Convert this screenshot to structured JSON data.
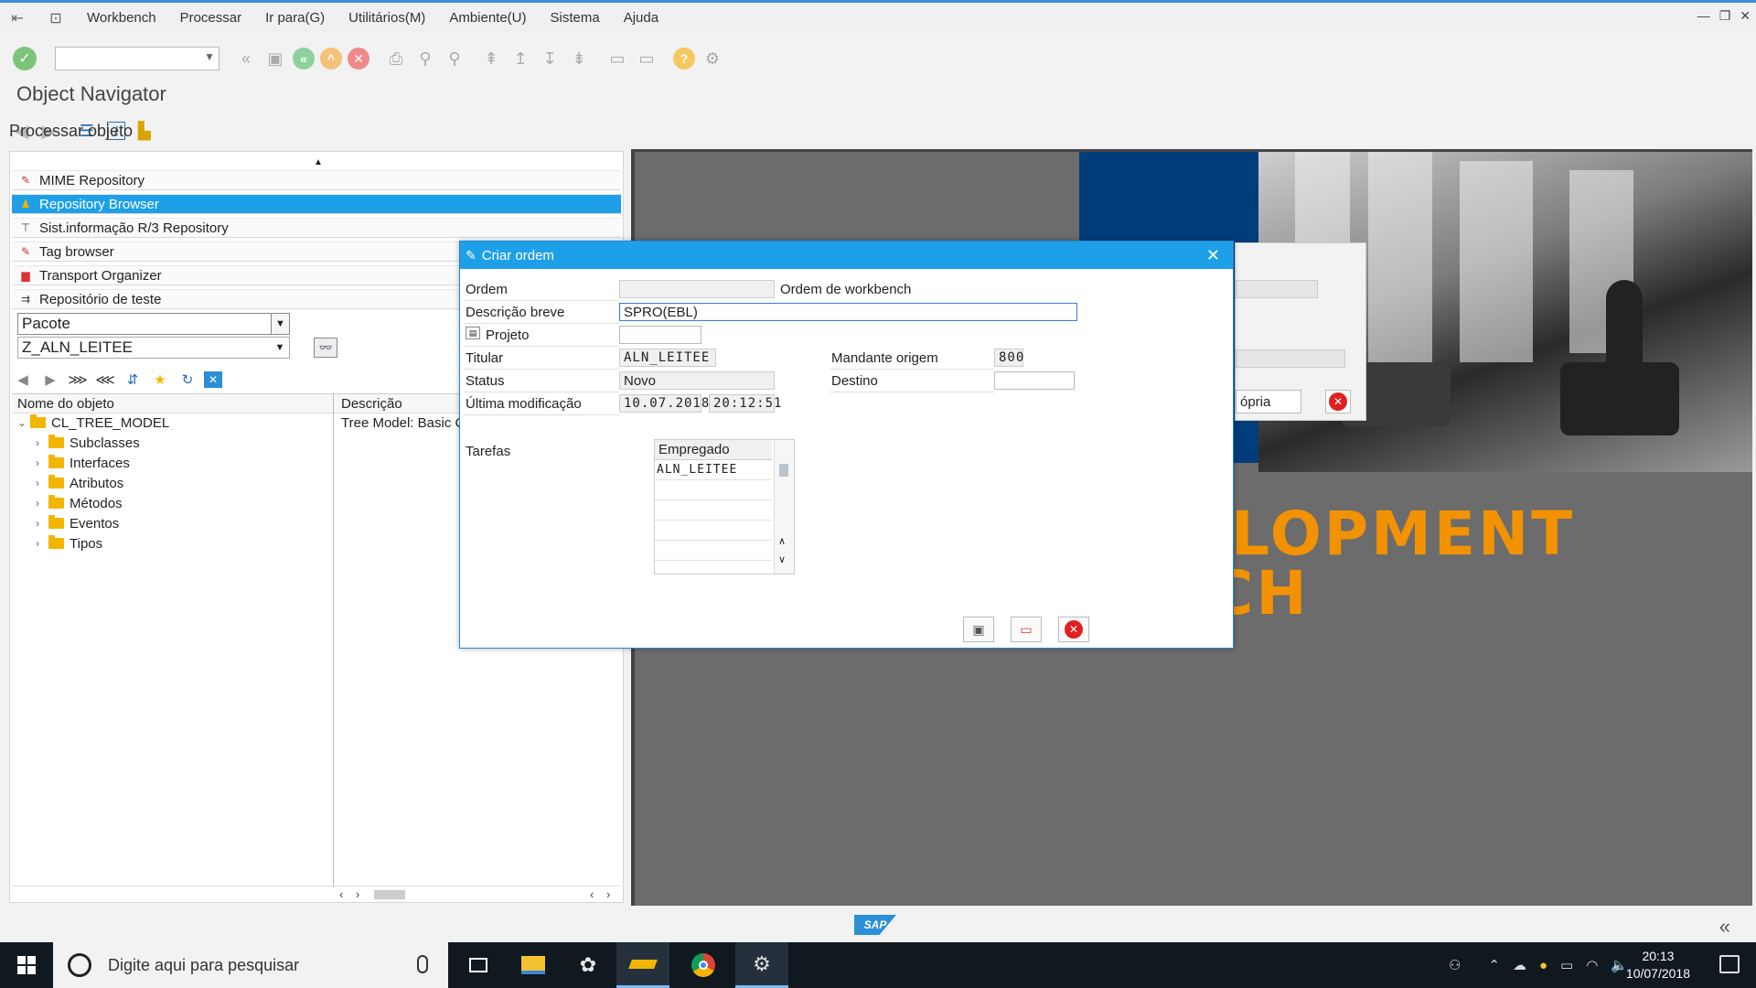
{
  "menubar": {
    "items": [
      "Workbench",
      "Processar",
      "Ir para(G)",
      "Utilitários(M)",
      "Ambiente(U)",
      "Sistema",
      "Ajuda"
    ]
  },
  "page": {
    "title": "Object Navigator"
  },
  "apptoolbar": {
    "process_label": "Processar objeto"
  },
  "nav": {
    "items": [
      {
        "label": "MIME Repository",
        "icon": "mime-icon"
      },
      {
        "label": "Repository Browser",
        "icon": "repo-icon",
        "selected": true
      },
      {
        "label": "Sist.informação R/3 Repository",
        "icon": "info-system-icon"
      },
      {
        "label": "Tag browser",
        "icon": "tag-icon"
      },
      {
        "label": "Transport Organizer",
        "icon": "transport-icon"
      },
      {
        "label": "Repositório de teste",
        "icon": "test-repo-icon"
      }
    ],
    "object_type": "Pacote",
    "object_name": "Z_ALN_LEITEE"
  },
  "tree": {
    "col_name": "Nome do objeto",
    "col_desc": "Descrição",
    "root": {
      "label": "CL_TREE_MODEL",
      "desc": "Tree Model: Basic Cl"
    },
    "children": [
      "Subclasses",
      "Interfaces",
      "Atributos",
      "Métodos",
      "Eventos",
      "Tipos"
    ]
  },
  "background": {
    "banner_line1": "LOPMENT",
    "banner_line2": "CH",
    "behind_button": "ópria"
  },
  "dialog": {
    "title": "Criar ordem",
    "ordem_label": "Ordem",
    "ordem_value": "",
    "ordem_type": "Ordem de workbench",
    "descricao_label": "Descrição breve",
    "descricao_value": "SPRO(EBL)",
    "projeto_label": "Projeto",
    "projeto_value": "",
    "titular_label": "Titular",
    "titular_value": "ALN_LEITEE",
    "mandante_label": "Mandante origem",
    "mandante_value": "800",
    "status_label": "Status",
    "status_value": "Novo",
    "destino_label": "Destino",
    "destino_value": "",
    "ultima_label": "Última modificação",
    "ultima_date": "10.07.2018",
    "ultima_time": "20:12:51",
    "tarefas_label": "Tarefas",
    "tarefas_header": "Empregado",
    "tarefas": [
      "ALN_LEITEE",
      "",
      "",
      "",
      ""
    ]
  },
  "taskbar": {
    "search_placeholder": "Digite aqui para pesquisar",
    "time": "20:13",
    "date": "10/07/2018"
  },
  "colors": {
    "accent": "#1ea0e8",
    "brand_orange": "#f39200",
    "sap_blue": "#003d7a"
  }
}
